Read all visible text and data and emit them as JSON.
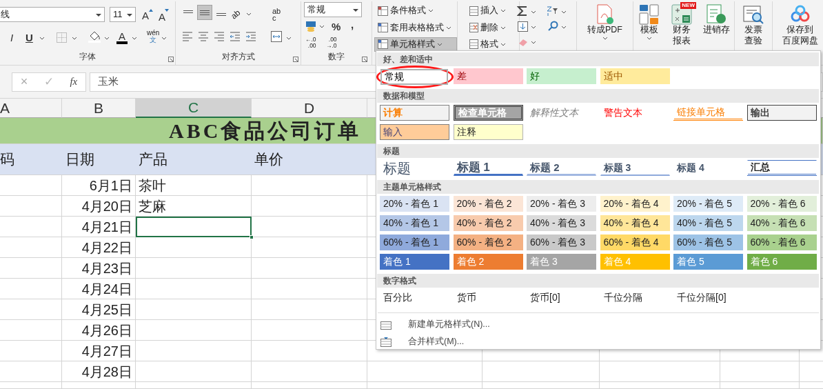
{
  "ribbon": {
    "font": {
      "name": "线",
      "size": "11",
      "grow": "A",
      "shrink": "A",
      "italic": "I",
      "underline": "U",
      "color_letter": "A",
      "phonetic_top": "wén",
      "phonetic_bottom": "文",
      "label": "字体"
    },
    "alignment": {
      "top_row": [
        {
          "kind": "top",
          "selected": false
        },
        {
          "kind": "middle",
          "selected": true
        },
        {
          "kind": "bottom",
          "selected": false
        }
      ],
      "orientation": "ab",
      "wrap_top": "ab",
      "wrap_bottom": "c",
      "label": "对齐方式"
    },
    "number": {
      "format": "常规",
      "percent": "%",
      "comma": ",",
      "increase_decimal": [
        "←.0",
        ".00"
      ],
      "decrease_decimal": [
        ".00",
        "→.0"
      ],
      "label": "数字"
    },
    "styles": [
      {
        "label": "条件格式",
        "selected": false
      },
      {
        "label": "套用表格格式",
        "selected": false
      },
      {
        "label": "单元格样式",
        "selected": true
      }
    ],
    "cells": [
      "插入",
      "删除",
      "格式"
    ],
    "big_buttons": [
      {
        "kind": "pdf",
        "lines": [
          "转成PDF"
        ]
      },
      {
        "kind": "template",
        "lines": [
          "模板"
        ]
      },
      {
        "kind": "finance",
        "lines": [
          "财务",
          "报表"
        ],
        "badge": "NEW"
      },
      {
        "kind": "inventory",
        "lines": [
          "进销存"
        ]
      },
      {
        "kind": "invoice",
        "lines": [
          "发票",
          "查验"
        ]
      },
      {
        "kind": "cloud",
        "lines": [
          "保存到",
          "百度网盘"
        ]
      }
    ]
  },
  "formula_bar": {
    "cancel": "×",
    "enter": "✓",
    "function": "fx",
    "value": "玉米"
  },
  "sheet": {
    "columns": [
      {
        "label": "A",
        "selected": false
      },
      {
        "label": "B",
        "selected": false
      },
      {
        "label": "C",
        "selected": true
      },
      {
        "label": "D",
        "selected": false
      }
    ],
    "title": "ABC食品公司订单",
    "headers": [
      "码",
      "日期",
      "产品",
      "单价"
    ],
    "rows": [
      {
        "date": "6月1日",
        "product": "茶叶",
        "selected": false
      },
      {
        "date": "4月20日",
        "product": "芝麻",
        "selected": false
      },
      {
        "date": "4月21日",
        "selected": true
      },
      {
        "date": "4月22日",
        "selected": false
      },
      {
        "date": "4月23日",
        "selected": false
      },
      {
        "date": "4月24日",
        "selected": false
      },
      {
        "date": "4月25日",
        "selected": false
      },
      {
        "date": "4月26日",
        "selected": false
      },
      {
        "date": "4月27日",
        "selected": false
      },
      {
        "date": "4月28日",
        "selected": false
      }
    ]
  },
  "cell_styles_menu": {
    "sections": [
      {
        "title": "好、差和适中",
        "items": [
          {
            "label": "常规",
            "kind": "normal"
          },
          {
            "label": "差",
            "kind": "bad"
          },
          {
            "label": "好",
            "kind": "good"
          },
          {
            "label": "适中",
            "kind": "neutral"
          }
        ]
      },
      {
        "title": "数据和模型",
        "items": [
          {
            "label": "计算",
            "kind": "calc"
          },
          {
            "label": "检查单元格",
            "kind": "check"
          },
          {
            "label": "解释性文本",
            "kind": "explanatory"
          },
          {
            "label": "警告文本",
            "kind": "warning"
          },
          {
            "label": "链接单元格",
            "kind": "linked"
          },
          {
            "label": "输出",
            "kind": "output"
          },
          {
            "label": "输入",
            "kind": "input"
          },
          {
            "label": "注释",
            "kind": "note"
          }
        ]
      },
      {
        "title": "标题",
        "items": [
          {
            "label": "标题",
            "kind": "title"
          },
          {
            "label": "标题 1",
            "kind": "h1"
          },
          {
            "label": "标题 2",
            "kind": "h2"
          },
          {
            "label": "标题 3",
            "kind": "h3"
          },
          {
            "label": "标题 4",
            "kind": "h4"
          },
          {
            "label": "汇总",
            "kind": "total"
          }
        ]
      },
      {
        "title": "主题单元格样式",
        "items": [
          {
            "label": "20% - 着色 1",
            "kind": "tint",
            "color": "#dae3f3"
          },
          {
            "label": "20% - 着色 2",
            "kind": "tint",
            "color": "#fbe5d6"
          },
          {
            "label": "20% - 着色 3",
            "kind": "tint",
            "color": "#ededed"
          },
          {
            "label": "20% - 着色 4",
            "kind": "tint",
            "color": "#fff2cc"
          },
          {
            "label": "20% - 着色 5",
            "kind": "tint",
            "color": "#deebf7"
          },
          {
            "label": "20% - 着色 6",
            "kind": "tint",
            "color": "#e2efda"
          },
          {
            "label": "40% - 着色 1",
            "kind": "tint",
            "color": "#b4c7e7"
          },
          {
            "label": "40% - 着色 2",
            "kind": "tint",
            "color": "#f8cbad"
          },
          {
            "label": "40% - 着色 3",
            "kind": "tint",
            "color": "#dbdbdb"
          },
          {
            "label": "40% - 着色 4",
            "kind": "tint",
            "color": "#ffe699"
          },
          {
            "label": "40% - 着色 5",
            "kind": "tint",
            "color": "#bdd7ee"
          },
          {
            "label": "40% - 着色 6",
            "kind": "tint",
            "color": "#c6e0b4"
          },
          {
            "label": "60% - 着色 1",
            "kind": "tint",
            "color": "#8faadc"
          },
          {
            "label": "60% - 着色 2",
            "kind": "tint",
            "color": "#f4b183"
          },
          {
            "label": "60% - 着色 3",
            "kind": "tint",
            "color": "#c9c9c9"
          },
          {
            "label": "60% - 着色 4",
            "kind": "tint",
            "color": "#ffd966"
          },
          {
            "label": "60% - 着色 5",
            "kind": "tint",
            "color": "#9dc3e6"
          },
          {
            "label": "60% - 着色 6",
            "kind": "tint",
            "color": "#a9d18e"
          },
          {
            "label": "着色 1",
            "kind": "solid",
            "color": "#4472c4"
          },
          {
            "label": "着色 2",
            "kind": "solid",
            "color": "#ed7d31"
          },
          {
            "label": "着色 3",
            "kind": "solid",
            "color": "#a5a5a5"
          },
          {
            "label": "着色 4",
            "kind": "solid",
            "color": "#ffc000"
          },
          {
            "label": "着色 5",
            "kind": "solid",
            "color": "#5b9bd5"
          },
          {
            "label": "着色 6",
            "kind": "solid",
            "color": "#70ad47"
          }
        ]
      },
      {
        "title": "数字格式",
        "items": [
          {
            "label": "百分比",
            "kind": "plain"
          },
          {
            "label": "货币",
            "kind": "plain"
          },
          {
            "label": "货币[0]",
            "kind": "plain"
          },
          {
            "label": "千位分隔",
            "kind": "plain"
          },
          {
            "label": "千位分隔[0]",
            "kind": "plain"
          }
        ]
      }
    ],
    "actions": [
      {
        "kind": "new",
        "label": "新建单元格样式(N)..."
      },
      {
        "kind": "merge",
        "label": "合并样式(M)..."
      }
    ]
  },
  "annotation": {
    "kind": "circle",
    "color": "#ff1a1a"
  }
}
